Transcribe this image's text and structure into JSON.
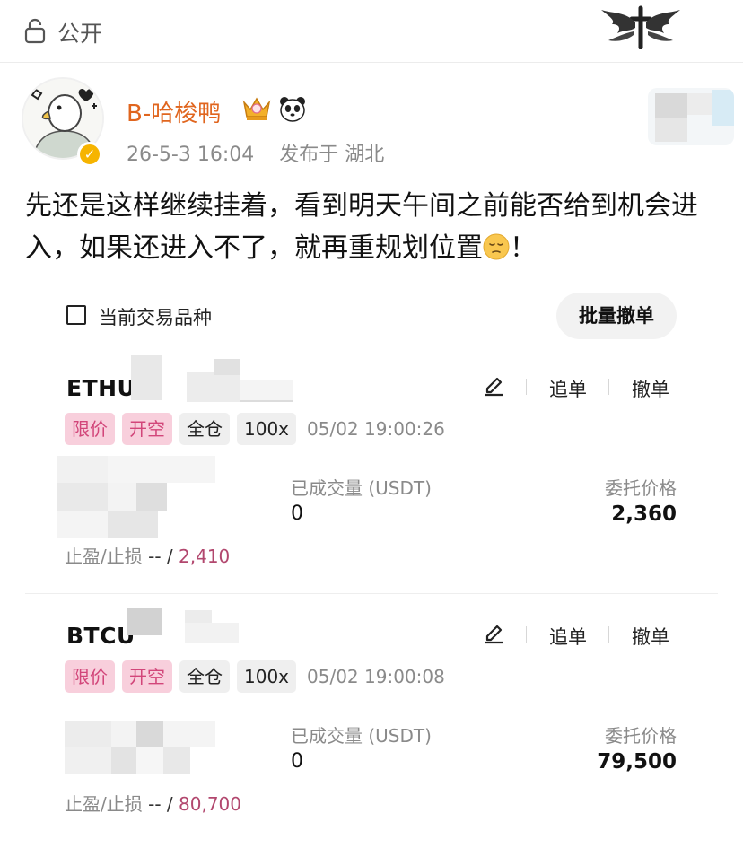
{
  "header": {
    "visibility_label": "公开",
    "lock_icon": "lock-icon",
    "emblem_icon": "winged-cross-emblem"
  },
  "post": {
    "author": "B-哈梭鸭",
    "time": "26-5-3 16:04",
    "location": "发布于 湖北",
    "text": "先还是这样继续挂着，看到明天午间之前能否给到机会进入，如果还进入不了，就再重规划位置",
    "text_end": "！"
  },
  "card": {
    "filter_label": "当前交易品种",
    "batch_cancel_label": "批量撤单",
    "orders": [
      {
        "symbol": "ETHU",
        "edit_icon": "edit-icon",
        "chase_label": "追单",
        "cancel_label": "撤单",
        "tag_type": "限价",
        "tag_side": "开空",
        "tag_margin": "全仓",
        "tag_leverage": "100x",
        "time": "05/02 19:00:26",
        "filled_label": "已成交量 (USDT)",
        "filled_value": "0",
        "price_label": "委托价格",
        "price_value": "2,360",
        "tpsl_label": "止盈/止损",
        "tp": "--",
        "slash": "/",
        "sl": "2,410"
      },
      {
        "symbol": "BTCU",
        "edit_icon": "edit-icon",
        "chase_label": "追单",
        "cancel_label": "撤单",
        "tag_type": "限价",
        "tag_side": "开空",
        "tag_margin": "全仓",
        "tag_leverage": "100x",
        "time": "05/02 19:00:08",
        "filled_label": "已成交量 (USDT)",
        "filled_value": "0",
        "price_label": "委托价格",
        "price_value": "79,500",
        "tpsl_label": "止盈/止损",
        "tp": "--",
        "slash": "/",
        "sl": "80,700"
      }
    ]
  }
}
